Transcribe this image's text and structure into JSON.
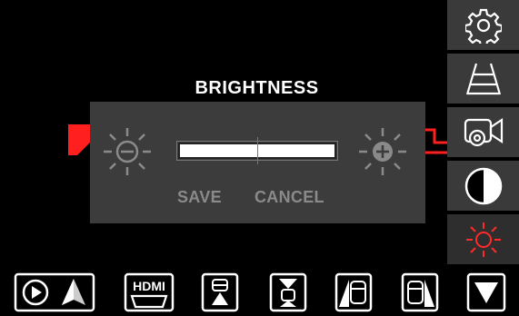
{
  "dialog": {
    "title": "BRIGHTNESS",
    "save_label": "SAVE",
    "cancel_label": "CANCEL",
    "brightness_level": 0.5
  },
  "sidebar": {
    "items": [
      {
        "name": "settings-gear-icon"
      },
      {
        "name": "parking-guidelines-icon"
      },
      {
        "name": "camera-settings-icon"
      },
      {
        "name": "contrast-icon"
      },
      {
        "name": "brightness-icon",
        "active": true
      }
    ]
  },
  "bottom_bar": {
    "items": [
      {
        "name": "carplay-android-auto-icon"
      },
      {
        "name": "hdmi-label",
        "text": "HDMI"
      },
      {
        "name": "front-camera-view-icon"
      },
      {
        "name": "front-rear-camera-view-icon"
      },
      {
        "name": "left-side-camera-icon"
      },
      {
        "name": "right-side-camera-icon"
      },
      {
        "name": "scroll-down-icon"
      }
    ]
  },
  "colors": {
    "accent_red": "#ff2a2a",
    "sidebar_bg": "#3a3a3a",
    "dialog_bg": "#3c3c3c",
    "disabled_text": "#8a8a8a"
  }
}
